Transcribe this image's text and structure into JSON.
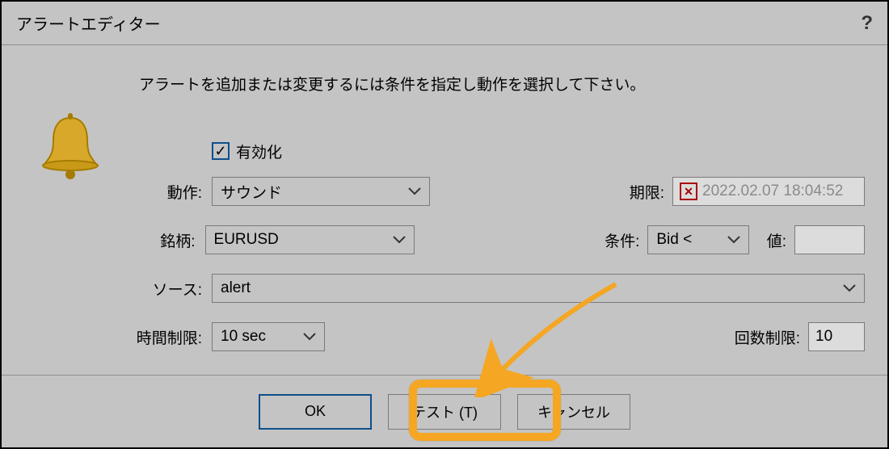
{
  "title": "アラートエディター",
  "help_symbol": "?",
  "instruction": "アラートを追加または変更するには条件を指定し動作を選択して下さい。",
  "enable": {
    "label": "有効化",
    "checked": true
  },
  "labels": {
    "action": "動作:",
    "symbol": "銘柄:",
    "source": "ソース:",
    "timelimit": "時間制限:",
    "expiry": "期限:",
    "condition": "条件:",
    "value": "値:",
    "count": "回数制限:"
  },
  "values": {
    "action": "サウンド",
    "symbol": "EURUSD",
    "source": "alert",
    "timelimit": "10 sec",
    "expiry": "2022.02.07 18:04:52",
    "condition": "Bid <",
    "value": "",
    "count": "10"
  },
  "buttons": {
    "ok": "OK",
    "test": "テスト (T)",
    "cancel": "キャンセル"
  }
}
